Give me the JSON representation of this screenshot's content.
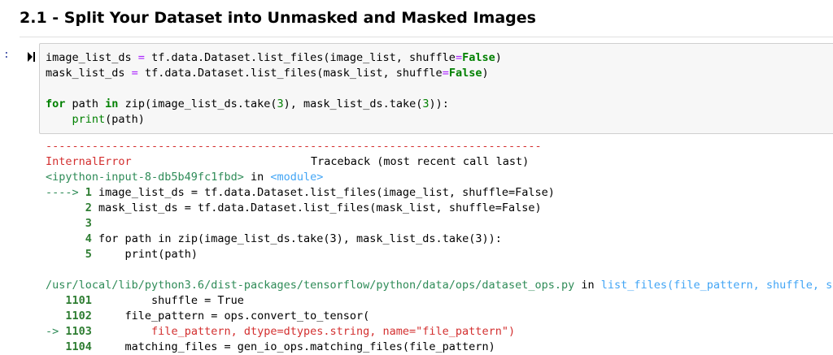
{
  "header": {
    "title": "2.1 - Split Your Dataset into Unmasked and Masked Images"
  },
  "cell": {
    "prompt": ":",
    "input_lines": [
      {
        "parts": [
          "image_list_ds ",
          "=",
          " tf.data.Dataset.list_files(image_list, shuffle",
          "=",
          "False",
          ")"
        ]
      },
      {
        "parts": [
          "mask_list_ds ",
          "=",
          " tf.data.Dataset.list_files(mask_list, shuffle",
          "=",
          "False",
          ")"
        ]
      },
      {
        "parts": [
          "for",
          " path ",
          "in",
          " zip(image_list_ds.take(",
          "3",
          "), mask_list_ds.take(",
          "3",
          ")):"
        ]
      },
      {
        "parts": [
          "    ",
          "print",
          "(path)"
        ]
      }
    ]
  },
  "output": {
    "separator": "---------------------------------------------------------------------------",
    "error_name": "InternalError",
    "traceback_header": "Traceback (most recent call last)",
    "input_ref": "<ipython-input-8-db5b49fc1fbd>",
    "in_word": " in ",
    "module_ref": "<module>",
    "frame1": [
      {
        "marker": "---->",
        "num": "1",
        "code": " image_list_ds = tf.data.Dataset.list_files(image_list, shuffle=False)"
      },
      {
        "marker": "     ",
        "num": "2",
        "code": " mask_list_ds = tf.data.Dataset.list_files(mask_list, shuffle=False)"
      },
      {
        "marker": "     ",
        "num": "3",
        "code": ""
      },
      {
        "marker": "     ",
        "num": "4",
        "code": " for path in zip(image_list_ds.take(3), mask_list_ds.take(3)):"
      },
      {
        "marker": "     ",
        "num": "5",
        "code": "     print(path)"
      }
    ],
    "file_path": "/usr/local/lib/python3.6/dist-packages/tensorflow/python/data/ops/dataset_ops.py",
    "func_ref": "list_files(file_pattern, shuffle, seed)",
    "frame2": [
      {
        "marker": "   ",
        "num": "1101",
        "code": "         shuffle = True"
      },
      {
        "marker": "   ",
        "num": "1102",
        "code": "     file_pattern = ops.convert_to_tensor("
      },
      {
        "marker": "-> ",
        "num": "1103",
        "code": "         file_pattern, dtype=dtypes.string, name=\"file_pattern\")"
      },
      {
        "marker": "   ",
        "num": "1104",
        "code": "     matching_files = gen_io_ops.matching_files(file_pattern)"
      }
    ]
  }
}
